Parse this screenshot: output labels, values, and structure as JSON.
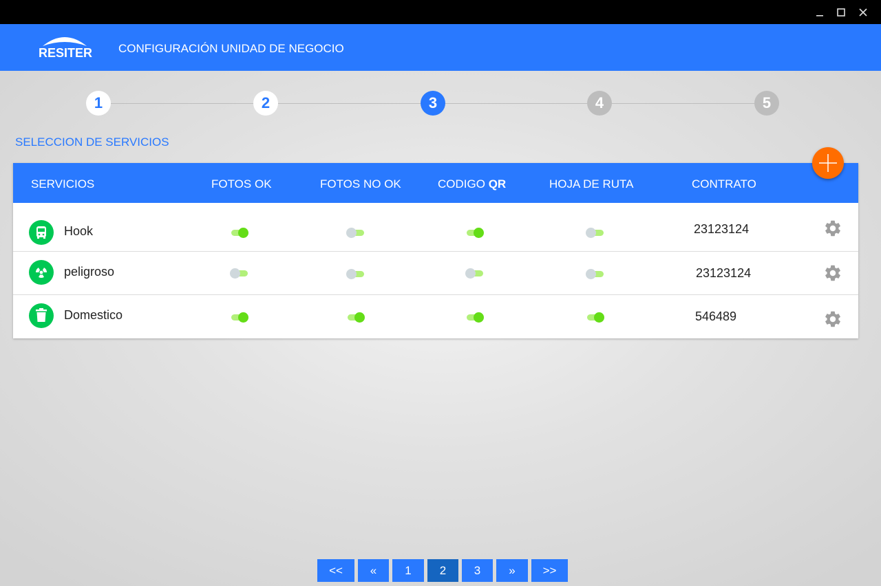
{
  "window": {
    "minimize_icon": "minimize-icon",
    "maximize_icon": "maximize-icon",
    "close_icon": "close-icon"
  },
  "header": {
    "logo_text": "RESITER",
    "title": "CONFIGURACIÓN UNIDAD DE NEGOCIO"
  },
  "stepper": {
    "steps": [
      "1",
      "2",
      "3",
      "4",
      "5"
    ],
    "current": 3
  },
  "section_title": "SELECCION DE SERVICIOS",
  "table": {
    "columns": {
      "services": "SERVICIOS",
      "fotos_ok": "FOTOS OK",
      "fotos_no_ok": "FOTOS NO OK",
      "codigo": "CODIGO",
      "codigo_bold": "QR",
      "hoja_de_ruta": "HOJA DE RUTA",
      "contrato": "CONTRATO"
    },
    "rows": [
      {
        "icon": "bus-icon",
        "name": "Hook",
        "fotos_ok": true,
        "fotos_no_ok": false,
        "codigo_qr": true,
        "hoja_de_ruta": false,
        "contrato": "23123124"
      },
      {
        "icon": "radiation-icon",
        "name": "peligroso",
        "fotos_ok": false,
        "fotos_no_ok": false,
        "codigo_qr": false,
        "hoja_de_ruta": false,
        "contrato": "23123124"
      },
      {
        "icon": "trash-icon",
        "name": "Domestico",
        "fotos_ok": true,
        "fotos_no_ok": true,
        "codigo_qr": true,
        "hoja_de_ruta": true,
        "contrato": "546489"
      }
    ]
  },
  "colors": {
    "primary": "#2979ff",
    "accent": "#ff6d00",
    "service_icon": "#00c853",
    "toggle_on": "#64dd17"
  },
  "pagination": {
    "first": "<<",
    "prev": "«",
    "pages": [
      "1",
      "2",
      "3"
    ],
    "current_page": "2",
    "next": "»",
    "last": ">>"
  }
}
